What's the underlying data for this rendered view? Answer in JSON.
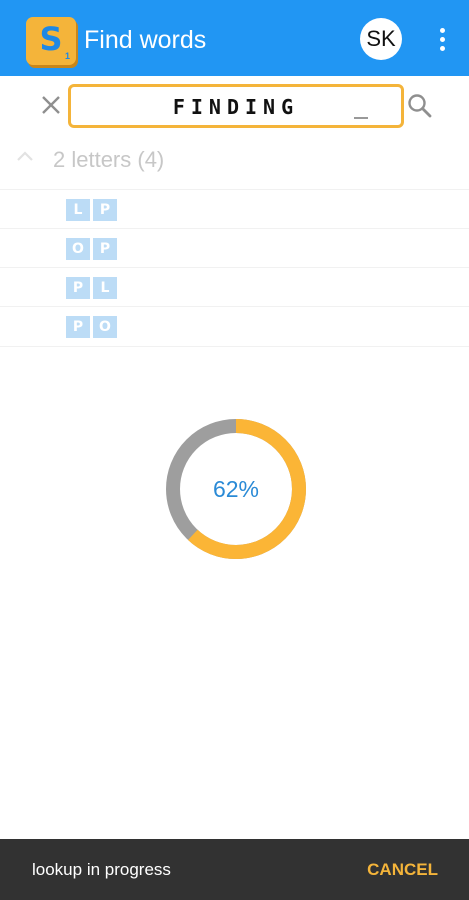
{
  "app_bar": {
    "logo_letter": "S",
    "logo_sub": "1",
    "title": "Find words",
    "avatar_initials": "SK",
    "background": "#2196f3"
  },
  "search": {
    "value": "FINDING",
    "clear_icon": "close-icon",
    "search_icon": "search-icon",
    "border_color": "#f4b43a"
  },
  "results": {
    "section_title": "2 letters (4)",
    "expand_icon": "chevron-up-icon",
    "words": [
      [
        "L",
        "P"
      ],
      [
        "O",
        "P"
      ],
      [
        "P",
        "L"
      ],
      [
        "P",
        "O"
      ]
    ]
  },
  "progress": {
    "label": "62%",
    "fraction": 0.62,
    "fill_color": "#fbb536",
    "track_color": "#9e9e9e"
  },
  "snackbar": {
    "message": "lookup in progress",
    "action": "CANCEL"
  }
}
